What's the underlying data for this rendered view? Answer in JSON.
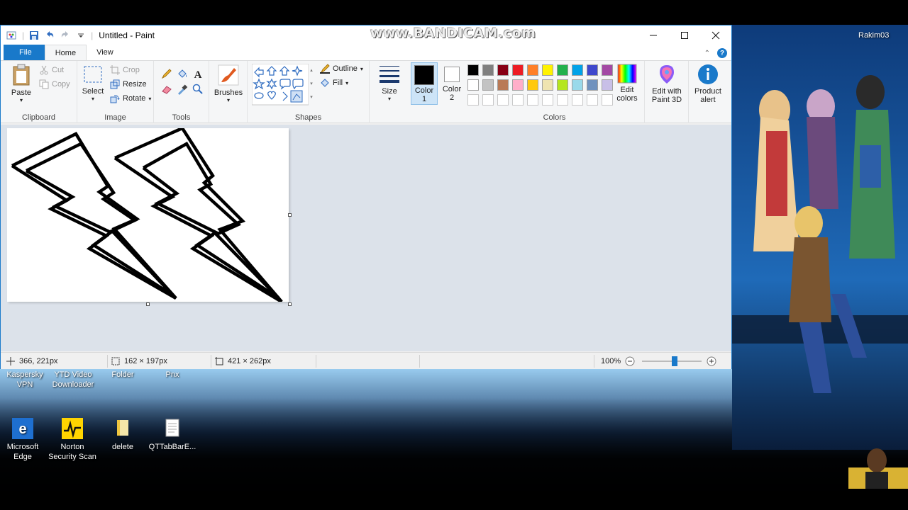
{
  "watermark": "www.BANDICAM.com",
  "desktop": {
    "user_label": "Rakim03",
    "icons": [
      {
        "label_line1": "Kaspersky",
        "label_line2": "VPN"
      },
      {
        "label_line1": "YTD Video",
        "label_line2": "Downloader"
      },
      {
        "label_line1": "Folder",
        "label_line2": ""
      },
      {
        "label_line1": "Pnx",
        "label_line2": ""
      },
      {
        "label_line1": "Microsoft",
        "label_line2": "Edge"
      },
      {
        "label_line1": "Norton",
        "label_line2": "Security Scan"
      },
      {
        "label_line1": "delete",
        "label_line2": ""
      },
      {
        "label_line1": "QTTabBarE...",
        "label_line2": ""
      }
    ]
  },
  "window": {
    "title": "Untitled - Paint",
    "tabs": {
      "file": "File",
      "home": "Home",
      "view": "View"
    }
  },
  "ribbon": {
    "clipboard": {
      "label": "Clipboard",
      "paste": "Paste",
      "cut": "Cut",
      "copy": "Copy"
    },
    "image": {
      "label": "Image",
      "select": "Select",
      "crop": "Crop",
      "resize": "Resize",
      "rotate": "Rotate"
    },
    "tools": {
      "label": "Tools"
    },
    "brushes": {
      "label": "Brushes"
    },
    "shapes": {
      "label": "Shapes",
      "outline": "Outline",
      "fill": "Fill"
    },
    "size": {
      "label": "Size"
    },
    "color1": {
      "label": "Color",
      "num": "1"
    },
    "color2": {
      "label": "Color",
      "num": "2"
    },
    "colors": {
      "label": "Colors",
      "row1": [
        "#000000",
        "#7f7f7f",
        "#880015",
        "#ed1c24",
        "#ff7f27",
        "#fff200",
        "#22b14c",
        "#00a2e8",
        "#3f48cc",
        "#a349a4"
      ],
      "row2": [
        "#ffffff",
        "#c3c3c3",
        "#b97a57",
        "#ffaec9",
        "#ffc90e",
        "#efe4b0",
        "#b5e61d",
        "#99d9ea",
        "#7092be",
        "#c8bfe7"
      ]
    },
    "edit_colors": {
      "line1": "Edit",
      "line2": "colors"
    },
    "paint3d": {
      "line1": "Edit with",
      "line2": "Paint 3D"
    },
    "product_alert": {
      "line1": "Product",
      "line2": "alert"
    }
  },
  "status": {
    "cursor": "366, 221px",
    "selection": "162 × 197px",
    "canvas_size": "421 × 262px",
    "zoom": "100%",
    "zoom_level": 0.55
  }
}
